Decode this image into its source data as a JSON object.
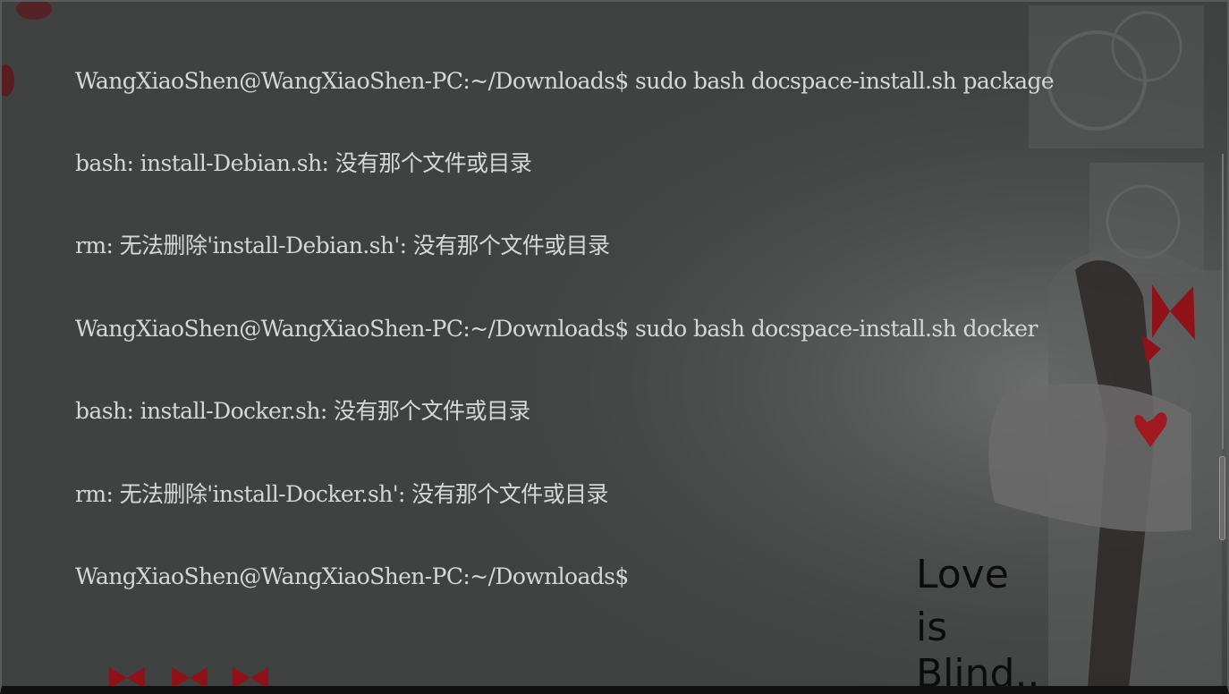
{
  "terminal": {
    "lines": [
      "WangXiaoShen@WangXiaoShen-PC:~/Downloads$ sudo bash docspace-install.sh package",
      "bash: install-Debian.sh: 没有那个文件或目录",
      "rm: 无法删除'install-Debian.sh': 没有那个文件或目录",
      "WangXiaoShen@WangXiaoShen-PC:~/Downloads$ sudo bash docspace-install.sh docker",
      "bash: install-Docker.sh: 没有那个文件或目录",
      "rm: 无法删除'install-Docker.sh': 没有那个文件或目录",
      "WangXiaoShen@WangXiaoShen-PC:~/Downloads$"
    ]
  },
  "wallpaper": {
    "caption_line1": "Love",
    "caption_line2": "is",
    "caption_line3": "Blind..",
    "accent_color": "#b0141c"
  },
  "scrollbar": {
    "position_fraction": 0.72
  }
}
